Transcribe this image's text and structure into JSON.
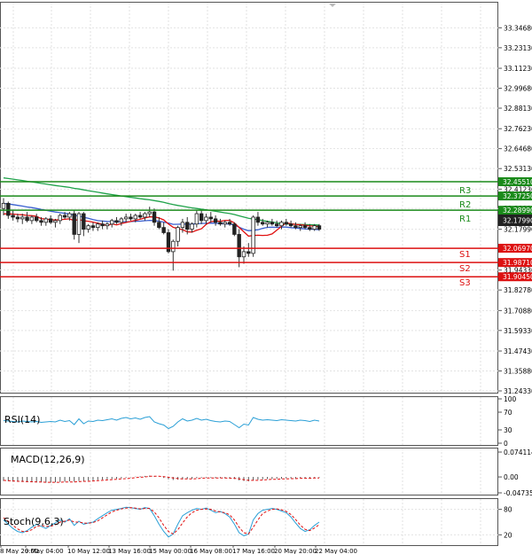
{
  "colors": {
    "grid": "#e2e2e2",
    "frame": "#555555",
    "resistance": "#1a8a1a",
    "support": "#dd1111",
    "price_box": "#222222",
    "ma_blue": "#3a5fd0",
    "ma_red": "#e01010",
    "ma_green": "#1fa24a",
    "candle_up": "#1a8a1a",
    "candle_down": "#dd1111",
    "osc": "#2a9fd6",
    "signal": "#e01010",
    "macd_hist": "#555555"
  },
  "chart_data": [
    {
      "type": "candlestick",
      "panel": "price",
      "y_tick_labels": [
        "33.34680",
        "33.23130",
        "33.11230",
        "32.99680",
        "32.88130",
        "32.76230",
        "32.64680",
        "32.53130",
        "32.41230",
        "32.29990",
        "32.17990",
        "32.06970",
        "31.94330",
        "31.82780",
        "31.70880",
        "31.59330",
        "31.47430",
        "31.35880",
        "31.24330"
      ],
      "ylim": [
        31.2433,
        33.4668
      ],
      "x_tick_labels": [
        "8 May 20:00",
        "9 May 04:00",
        "10 May 12:00",
        "13 May 16:00",
        "15 May 00:00",
        "16 May 08:00",
        "17 May 16:00",
        "20 May 20:00",
        "22 May 04:00"
      ],
      "current_price": "32.17990",
      "levels": [
        {
          "name": "R3",
          "value": 32.4551,
          "label": "32.45510",
          "kind": "resistance"
        },
        {
          "name": "R2",
          "value": 32.3725,
          "label": "32.37250",
          "kind": "resistance"
        },
        {
          "name": "R1",
          "value": 32.2899,
          "label": "32.28990",
          "kind": "resistance"
        },
        {
          "name": "S1",
          "value": 32.0697,
          "label": "32.06970",
          "kind": "support"
        },
        {
          "name": "S2",
          "value": 31.9871,
          "label": "31.98710",
          "kind": "support"
        },
        {
          "name": "S3",
          "value": 31.9045,
          "label": "31.90450",
          "kind": "support"
        }
      ],
      "candles": [
        [
          32.3,
          32.36,
          32.26,
          32.33
        ],
        [
          32.33,
          32.34,
          32.24,
          32.26
        ],
        [
          32.26,
          32.29,
          32.23,
          32.25
        ],
        [
          32.25,
          32.27,
          32.22,
          32.24
        ],
        [
          32.24,
          32.27,
          32.21,
          32.25
        ],
        [
          32.25,
          32.28,
          32.22,
          32.23
        ],
        [
          32.23,
          32.26,
          32.21,
          32.25
        ],
        [
          32.25,
          32.27,
          32.22,
          32.23
        ],
        [
          32.23,
          32.25,
          32.2,
          32.22
        ],
        [
          32.22,
          32.25,
          32.2,
          32.24
        ],
        [
          32.24,
          32.26,
          32.21,
          32.22
        ],
        [
          32.22,
          32.24,
          32.19,
          32.23
        ],
        [
          32.23,
          32.27,
          32.21,
          32.26
        ],
        [
          32.26,
          32.28,
          32.24,
          32.25
        ],
        [
          32.25,
          32.28,
          32.23,
          32.27
        ],
        [
          32.27,
          32.29,
          32.12,
          32.15
        ],
        [
          32.15,
          32.28,
          32.1,
          32.27
        ],
        [
          32.27,
          32.28,
          32.14,
          32.18
        ],
        [
          32.18,
          32.21,
          32.16,
          32.2
        ],
        [
          32.2,
          32.22,
          32.17,
          32.19
        ],
        [
          32.19,
          32.22,
          32.17,
          32.21
        ],
        [
          32.21,
          32.23,
          32.18,
          32.2
        ],
        [
          32.2,
          32.22,
          32.18,
          32.21
        ],
        [
          32.21,
          32.24,
          32.19,
          32.23
        ],
        [
          32.23,
          32.25,
          32.21,
          32.22
        ],
        [
          32.22,
          32.25,
          32.2,
          32.24
        ],
        [
          32.24,
          32.27,
          32.22,
          32.25
        ],
        [
          32.25,
          32.27,
          32.23,
          32.24
        ],
        [
          32.24,
          32.27,
          32.22,
          32.26
        ],
        [
          32.26,
          32.28,
          32.24,
          32.25
        ],
        [
          32.25,
          32.28,
          32.23,
          32.27
        ],
        [
          32.27,
          32.31,
          32.25,
          32.28
        ],
        [
          32.28,
          32.3,
          32.2,
          32.22
        ],
        [
          32.22,
          32.25,
          32.18,
          32.19
        ],
        [
          32.19,
          32.22,
          32.15,
          32.16
        ],
        [
          32.16,
          32.18,
          32.04,
          32.05
        ],
        [
          32.05,
          32.12,
          31.94,
          32.11
        ],
        [
          32.11,
          32.2,
          32.08,
          32.19
        ],
        [
          32.19,
          32.24,
          32.16,
          32.22
        ],
        [
          32.22,
          32.25,
          32.15,
          32.18
        ],
        [
          32.18,
          32.22,
          32.16,
          32.21
        ],
        [
          32.21,
          32.29,
          32.19,
          32.27
        ],
        [
          32.27,
          32.29,
          32.21,
          32.23
        ],
        [
          32.23,
          32.27,
          32.21,
          32.25
        ],
        [
          32.25,
          32.28,
          32.22,
          32.24
        ],
        [
          32.24,
          32.26,
          32.2,
          32.22
        ],
        [
          32.22,
          32.24,
          32.2,
          32.21
        ],
        [
          32.21,
          32.23,
          32.19,
          32.22
        ],
        [
          32.22,
          32.24,
          32.2,
          32.21
        ],
        [
          32.21,
          32.22,
          32.14,
          32.15
        ],
        [
          32.15,
          32.18,
          31.96,
          32.02
        ],
        [
          32.02,
          32.08,
          31.98,
          32.05
        ],
        [
          32.05,
          32.1,
          32.02,
          32.04
        ],
        [
          32.04,
          32.26,
          32.02,
          32.25
        ],
        [
          32.25,
          32.28,
          32.2,
          32.22
        ],
        [
          32.22,
          32.24,
          32.2,
          32.21
        ],
        [
          32.21,
          32.23,
          32.19,
          32.22
        ],
        [
          32.22,
          32.24,
          32.2,
          32.21
        ],
        [
          32.21,
          32.23,
          32.19,
          32.2
        ],
        [
          32.2,
          32.23,
          32.18,
          32.22
        ],
        [
          32.22,
          32.24,
          32.2,
          32.21
        ],
        [
          32.21,
          32.23,
          32.19,
          32.2
        ],
        [
          32.2,
          32.22,
          32.18,
          32.19
        ],
        [
          32.19,
          32.21,
          32.17,
          32.2
        ],
        [
          32.2,
          32.22,
          32.18,
          32.19
        ],
        [
          32.19,
          32.21,
          32.17,
          32.18
        ],
        [
          32.18,
          32.21,
          32.17,
          32.2
        ],
        [
          32.2,
          32.21,
          32.17,
          32.18
        ]
      ]
    },
    {
      "type": "line",
      "panel": "oscillator",
      "title": "RSI(14)",
      "y_tick_labels": [
        "100",
        "70",
        "30",
        "0"
      ],
      "ylim": [
        0,
        100
      ],
      "series": [
        {
          "values": [
            51,
            50,
            49,
            48,
            50,
            49,
            48,
            49,
            47,
            48,
            49,
            48,
            52,
            49,
            51,
            42,
            55,
            44,
            50,
            49,
            52,
            51,
            53,
            55,
            52,
            56,
            58,
            55,
            57,
            54,
            58,
            60,
            48,
            44,
            41,
            33,
            38,
            48,
            55,
            50,
            52,
            56,
            52,
            54,
            51,
            49,
            48,
            50,
            49,
            42,
            35,
            43,
            41,
            58,
            54,
            52,
            53,
            52,
            51,
            53,
            52,
            51,
            50,
            52,
            51,
            49,
            52,
            50
          ]
        }
      ]
    },
    {
      "type": "bar",
      "panel": "oscillator",
      "title": "MACD(12,26,9)",
      "y_tick_labels": [
        "0.074114",
        "0.00",
        "-0.047351"
      ],
      "ylim": [
        -0.047351,
        0.074114
      ],
      "series": [
        {
          "name": "MACD",
          "values": [
            -0.012,
            -0.013,
            -0.014,
            -0.014,
            -0.015,
            -0.015,
            -0.016,
            -0.016,
            -0.016,
            -0.017,
            -0.017,
            -0.016,
            -0.015,
            -0.014,
            -0.013,
            -0.014,
            -0.012,
            -0.012,
            -0.011,
            -0.01,
            -0.009,
            -0.008,
            -0.007,
            -0.006,
            -0.005,
            -0.004,
            -0.002,
            -0.001,
            0.001,
            0.002,
            0.003,
            0.004,
            0.002,
            0.0,
            -0.003,
            -0.007,
            -0.009,
            -0.008,
            -0.007,
            -0.006,
            -0.005,
            -0.003,
            -0.002,
            -0.002,
            -0.002,
            -0.003,
            -0.003,
            -0.004,
            -0.004,
            -0.006,
            -0.01,
            -0.012,
            -0.013,
            -0.01,
            -0.008,
            -0.007,
            -0.006,
            -0.006,
            -0.005,
            -0.005,
            -0.004,
            -0.004,
            -0.004,
            -0.003,
            -0.003,
            -0.003,
            -0.002,
            -0.002
          ]
        },
        {
          "name": "Signal",
          "values": [
            -0.01,
            -0.011,
            -0.012,
            -0.013,
            -0.013,
            -0.014,
            -0.014,
            -0.015,
            -0.015,
            -0.016,
            -0.016,
            -0.016,
            -0.016,
            -0.015,
            -0.015,
            -0.015,
            -0.014,
            -0.013,
            -0.013,
            -0.012,
            -0.011,
            -0.01,
            -0.009,
            -0.008,
            -0.007,
            -0.006,
            -0.005,
            -0.004,
            -0.002,
            -0.001,
            0.0,
            0.002,
            0.002,
            0.002,
            0.001,
            -0.001,
            -0.003,
            -0.005,
            -0.006,
            -0.006,
            -0.006,
            -0.005,
            -0.004,
            -0.003,
            -0.003,
            -0.003,
            -0.003,
            -0.003,
            -0.004,
            -0.004,
            -0.006,
            -0.008,
            -0.01,
            -0.01,
            -0.01,
            -0.009,
            -0.008,
            -0.007,
            -0.007,
            -0.006,
            -0.006,
            -0.005,
            -0.005,
            -0.004,
            -0.004,
            -0.004,
            -0.003,
            -0.003
          ]
        }
      ]
    },
    {
      "type": "line",
      "panel": "oscillator",
      "title": "Stoch(9,6,3)",
      "y_tick_labels": [
        "80",
        "20"
      ],
      "ylim": [
        0,
        100
      ],
      "series": [
        {
          "name": "%K",
          "values": [
            55,
            45,
            35,
            28,
            25,
            30,
            38,
            45,
            40,
            35,
            42,
            48,
            55,
            50,
            58,
            42,
            52,
            45,
            48,
            50,
            58,
            65,
            72,
            78,
            80,
            82,
            85,
            84,
            82,
            80,
            84,
            82,
            65,
            45,
            28,
            15,
            22,
            45,
            65,
            72,
            78,
            82,
            80,
            83,
            78,
            72,
            75,
            70,
            62,
            45,
            25,
            18,
            22,
            55,
            70,
            78,
            80,
            82,
            80,
            76,
            72,
            62,
            48,
            35,
            28,
            32,
            42,
            50
          ]
        },
        {
          "name": "%D",
          "values": [
            60,
            52,
            42,
            34,
            28,
            28,
            32,
            40,
            42,
            40,
            40,
            44,
            50,
            52,
            55,
            50,
            50,
            48,
            47,
            49,
            53,
            60,
            67,
            74,
            78,
            81,
            83,
            84,
            83,
            81,
            82,
            82,
            74,
            60,
            42,
            28,
            22,
            32,
            48,
            62,
            72,
            78,
            80,
            81,
            80,
            76,
            74,
            72,
            67,
            55,
            38,
            25,
            22,
            38,
            55,
            70,
            76,
            80,
            81,
            79,
            75,
            68,
            56,
            43,
            33,
            30,
            36,
            44
          ]
        }
      ]
    }
  ]
}
